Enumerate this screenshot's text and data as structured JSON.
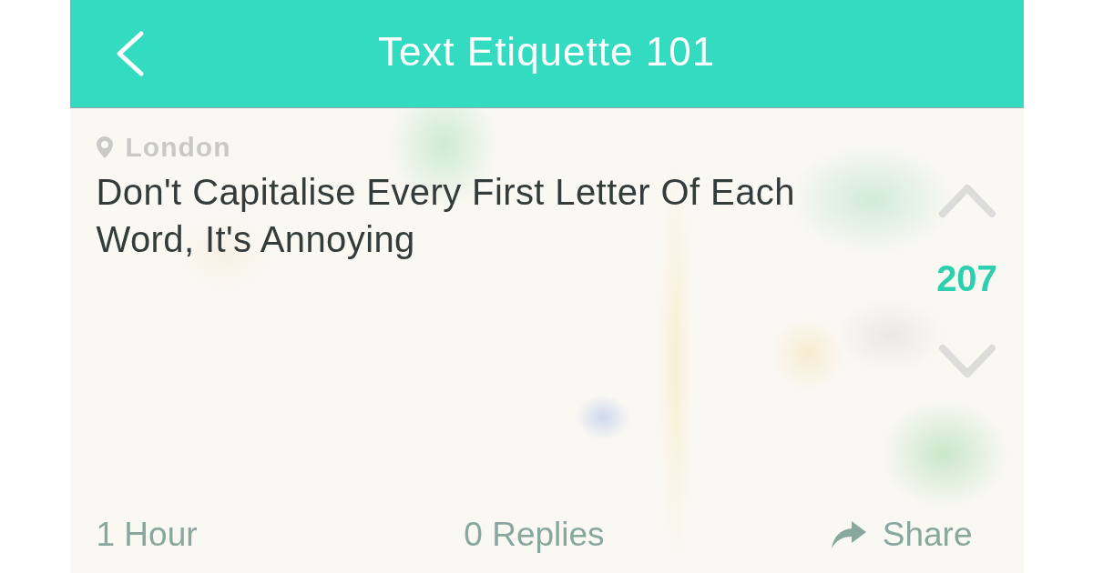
{
  "header": {
    "title": "Text Etiquette 101"
  },
  "post": {
    "location": "London",
    "message": "Don't Capitalise Every First Letter Of Each Word, It's Annoying",
    "votes": "207"
  },
  "footer": {
    "time": "1 Hour",
    "replies": "0 Replies",
    "share": "Share"
  }
}
